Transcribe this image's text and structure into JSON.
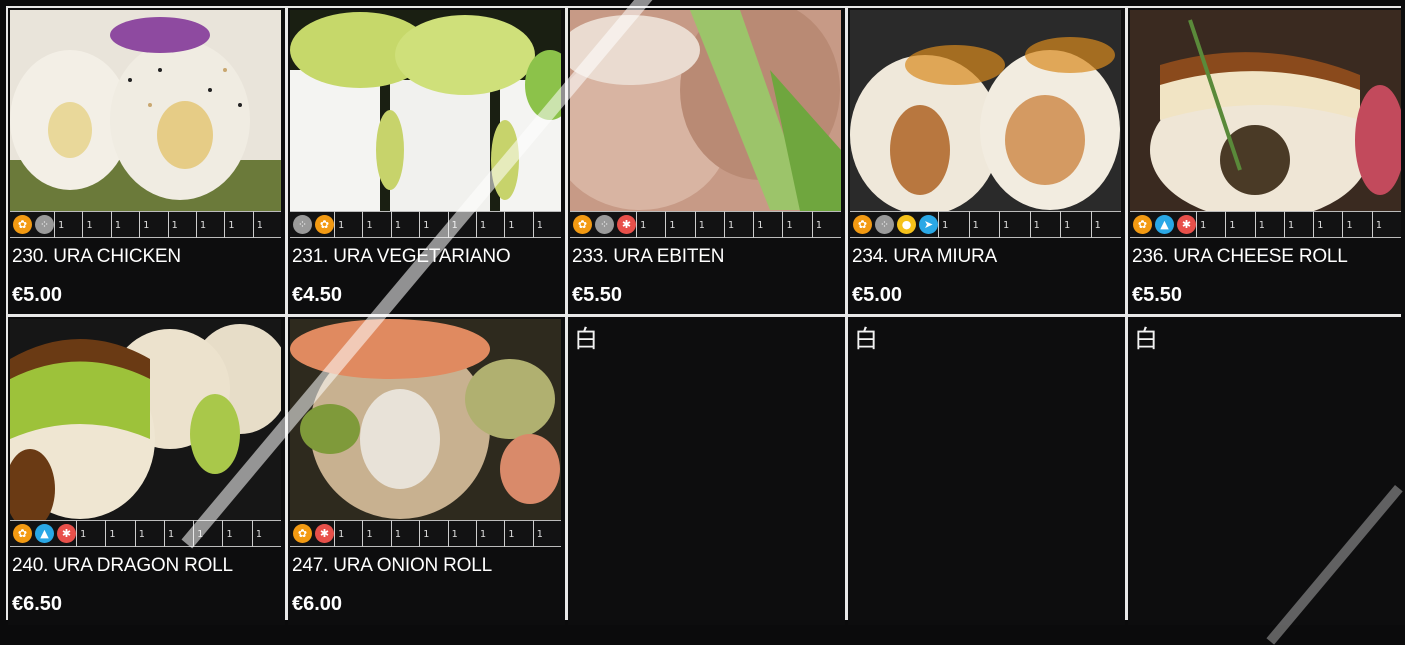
{
  "colors": {
    "gluten": "#f39a12",
    "sesame": "#9a9a9a",
    "crustacean": "#e8504a",
    "egg": "#f6c21a",
    "fish": "#2aa8e6",
    "lupin": "#2aa8e6"
  },
  "items": [
    {
      "name": "230. URA CHICKEN",
      "price": "€5.00",
      "allergens": [
        "gluten-icon",
        "sesame-icon"
      ],
      "slots": [
        "1",
        "1",
        "1",
        "1",
        "1",
        "1",
        "1",
        "1"
      ]
    },
    {
      "name": "231. URA VEGETARIANO",
      "price": "€4.50",
      "allergens": [
        "sesame-icon",
        "gluten-icon"
      ],
      "slots": [
        "1",
        "1",
        "1",
        "1",
        "1",
        "1",
        "1",
        "1"
      ]
    },
    {
      "name": "233. URA EBITEN",
      "price": "€5.50",
      "allergens": [
        "gluten-icon",
        "sesame-icon",
        "crustacean-icon"
      ],
      "slots": [
        "1",
        "1",
        "1",
        "1",
        "1",
        "1",
        "1"
      ]
    },
    {
      "name": "234. URA MIURA",
      "price": "€5.00",
      "allergens": [
        "gluten-icon",
        "sesame-icon",
        "egg-icon",
        "fish-icon"
      ],
      "slots": [
        "1",
        "1",
        "1",
        "1",
        "1",
        "1"
      ]
    },
    {
      "name": "236. URA CHEESE ROLL",
      "price": "€5.50",
      "allergens": [
        "gluten-icon",
        "lupin-icon",
        "crustacean-icon"
      ],
      "slots": [
        "1",
        "1",
        "1",
        "1",
        "1",
        "1",
        "1"
      ]
    },
    {
      "name": "240. URA DRAGON ROLL",
      "price": "€6.50",
      "allergens": [
        "gluten-icon",
        "lupin-icon",
        "crustacean-icon"
      ],
      "slots": [
        "1",
        "1",
        "1",
        "1",
        "1",
        "1",
        "1"
      ]
    },
    {
      "name": "247. URA ONION ROLL",
      "price": "€6.00",
      "allergens": [
        "gluten-icon",
        "crustacean-icon"
      ],
      "slots": [
        "1",
        "1",
        "1",
        "1",
        "1",
        "1",
        "1",
        "1"
      ]
    }
  ],
  "empty_glyph": "白"
}
